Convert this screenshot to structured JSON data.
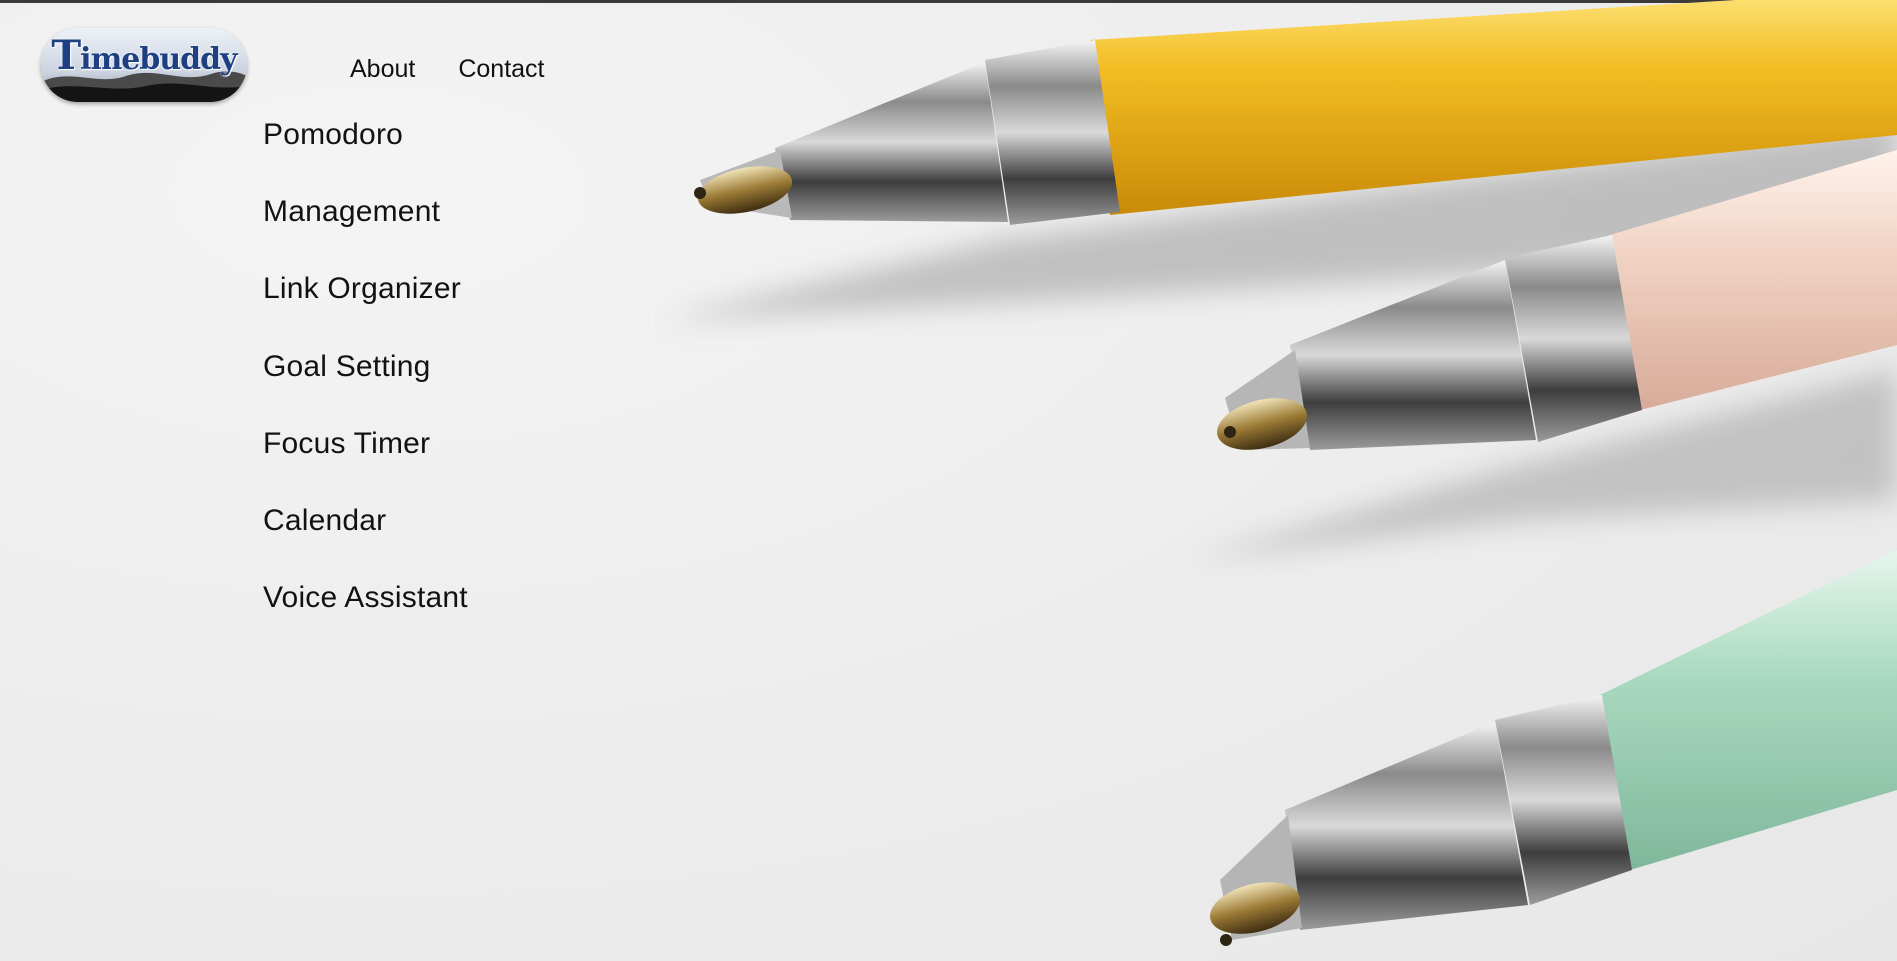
{
  "logo": {
    "text_first": "T",
    "text_rest": "imebuddy",
    "alt": "Timebuddy"
  },
  "nav": {
    "about_label": "About",
    "contact_label": "Contact"
  },
  "menu": {
    "items": [
      {
        "label": "Pomodoro"
      },
      {
        "label": "Management"
      },
      {
        "label": "Link Organizer"
      },
      {
        "label": "Goal Setting"
      },
      {
        "label": "Focus Timer"
      },
      {
        "label": "Calendar"
      },
      {
        "label": "Voice Assistant"
      }
    ]
  },
  "colors": {
    "pen_yellow": "#f0b41c",
    "pen_pink": "#f1d6c9",
    "pen_green": "#a8d8bf",
    "logo_blue": "#1e3f82",
    "text": "#111111"
  }
}
